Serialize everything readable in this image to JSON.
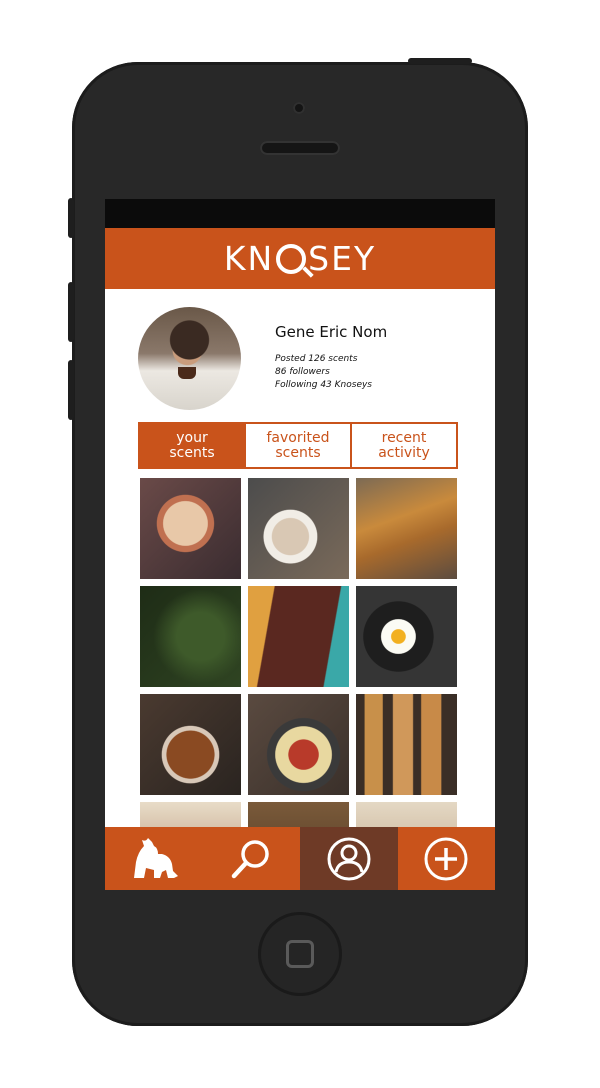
{
  "app": {
    "logo_text_pre": "KN",
    "logo_text_post": "SEY",
    "accent": "#c9531b"
  },
  "profile": {
    "name": "Gene Eric Nom",
    "posted": "Posted 126 scents",
    "followers": "86 followers",
    "following": "Following 43 Knoseys"
  },
  "tabs": [
    {
      "line1": "your",
      "line2": "scents",
      "active": true
    },
    {
      "line1": "favorited",
      "line2": "scents",
      "active": false
    },
    {
      "line1": "recent",
      "line2": "activity",
      "active": false
    }
  ],
  "photos": [
    "dessert-casserole",
    "coffee-cup",
    "pumpkin-pie",
    "pine-branches",
    "glazed-ribs",
    "fried-egg-pan",
    "braided-pastry",
    "sausage-pasta",
    "baguettes",
    "pie-crust",
    "roasted-dish",
    "tart"
  ],
  "nav": [
    {
      "icon": "dog-icon",
      "active": false
    },
    {
      "icon": "search-icon",
      "active": false
    },
    {
      "icon": "profile-icon",
      "active": true
    },
    {
      "icon": "add-icon",
      "active": false
    }
  ]
}
